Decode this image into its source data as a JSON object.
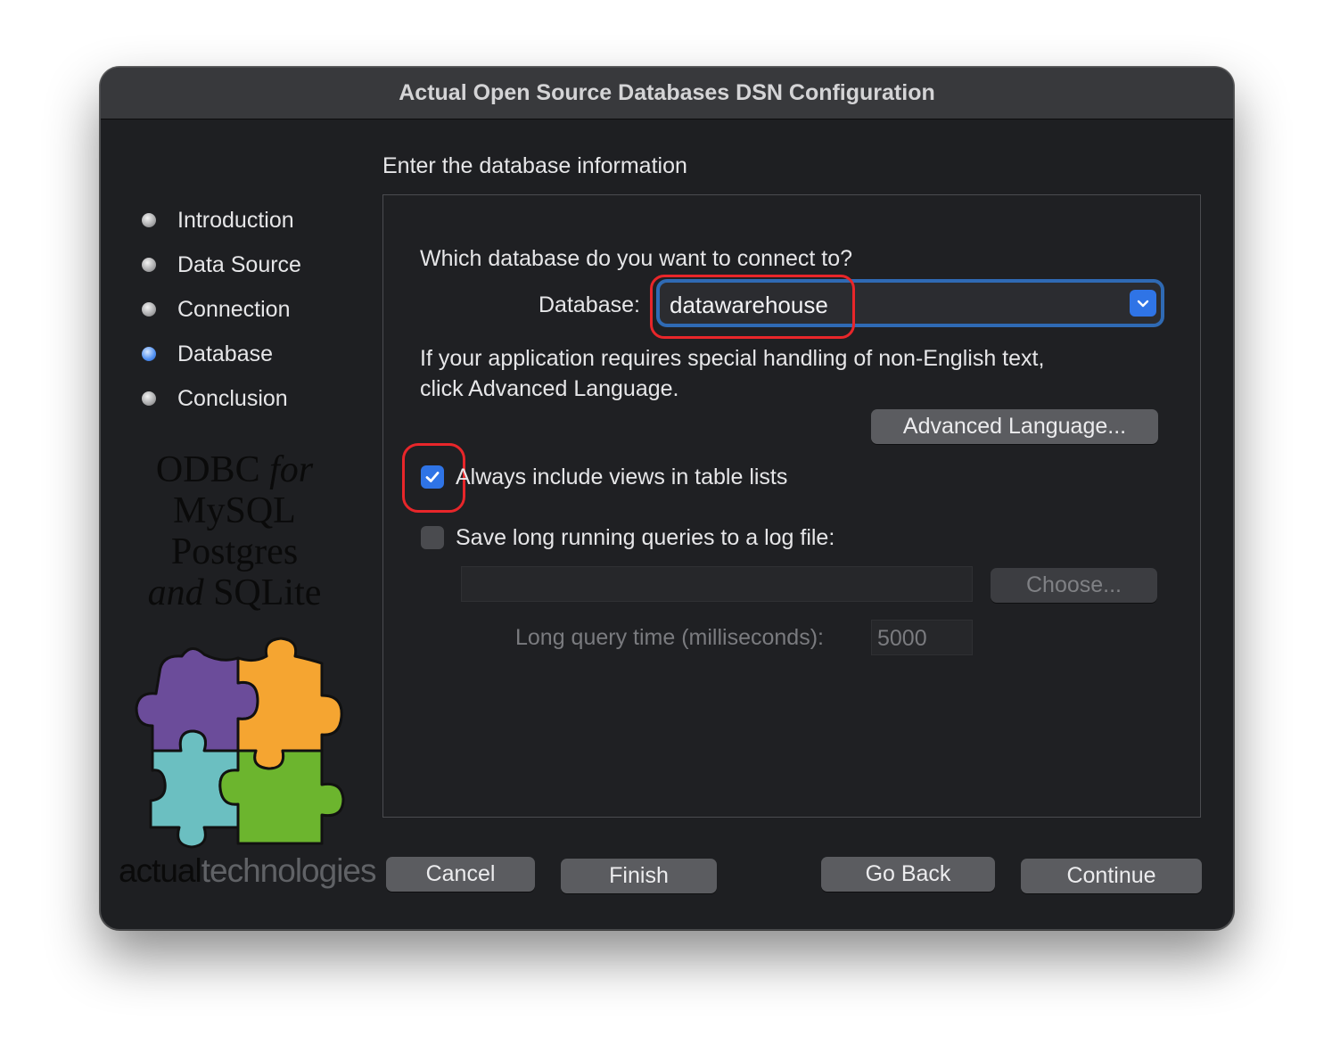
{
  "window": {
    "title": "Actual Open Source Databases DSN Configuration"
  },
  "sidebar": {
    "steps": [
      {
        "label": "Introduction",
        "active": false
      },
      {
        "label": "Data Source",
        "active": false
      },
      {
        "label": "Connection",
        "active": false
      },
      {
        "label": "Database",
        "active": true
      },
      {
        "label": "Conclusion",
        "active": false
      }
    ],
    "logo": {
      "line1_a": "ODBC ",
      "line1_b": "for",
      "line2": "MySQL",
      "line3": "Postgres",
      "line4_a": "and",
      "line4_b": " SQLite",
      "brand_a": "actual",
      "brand_b": "technologies",
      "puzzle_colors": [
        "#6b4c9a",
        "#f5a531",
        "#6bbfc1",
        "#6cb52e"
      ]
    }
  },
  "main": {
    "heading": "Enter the database information",
    "question": "Which database do you want to connect to?",
    "database_label": "Database:",
    "database_value": "datawarehouse",
    "lang_note_line1": "If your application requires special handling of non-English text,",
    "lang_note_line2": "click Advanced Language.",
    "advanced_language_button": "Advanced Language...",
    "include_views_label": "Always include views in table lists",
    "include_views_checked": true,
    "save_queries_label": "Save long running queries to a log file:",
    "save_queries_checked": false,
    "log_file_path": "",
    "choose_button": "Choose...",
    "long_query_label": "Long query time (milliseconds):",
    "long_query_value": "5000"
  },
  "footer": {
    "cancel": "Cancel",
    "finish": "Finish",
    "go_back": "Go Back",
    "continue": "Continue"
  },
  "colors": {
    "accent": "#2f74e6",
    "highlight_ring": "#e8262a"
  }
}
